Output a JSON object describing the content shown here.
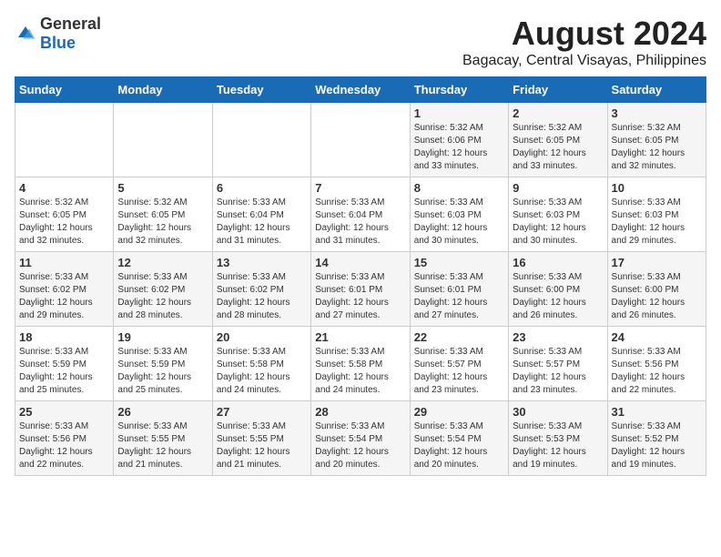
{
  "header": {
    "logo_general": "General",
    "logo_blue": "Blue",
    "month_year": "August 2024",
    "location": "Bagacay, Central Visayas, Philippines"
  },
  "days_of_week": [
    "Sunday",
    "Monday",
    "Tuesday",
    "Wednesday",
    "Thursday",
    "Friday",
    "Saturday"
  ],
  "weeks": [
    [
      {
        "day": "",
        "content": ""
      },
      {
        "day": "",
        "content": ""
      },
      {
        "day": "",
        "content": ""
      },
      {
        "day": "",
        "content": ""
      },
      {
        "day": "1",
        "content": "Sunrise: 5:32 AM\nSunset: 6:06 PM\nDaylight: 12 hours\nand 33 minutes."
      },
      {
        "day": "2",
        "content": "Sunrise: 5:32 AM\nSunset: 6:05 PM\nDaylight: 12 hours\nand 33 minutes."
      },
      {
        "day": "3",
        "content": "Sunrise: 5:32 AM\nSunset: 6:05 PM\nDaylight: 12 hours\nand 32 minutes."
      }
    ],
    [
      {
        "day": "4",
        "content": "Sunrise: 5:32 AM\nSunset: 6:05 PM\nDaylight: 12 hours\nand 32 minutes."
      },
      {
        "day": "5",
        "content": "Sunrise: 5:32 AM\nSunset: 6:05 PM\nDaylight: 12 hours\nand 32 minutes."
      },
      {
        "day": "6",
        "content": "Sunrise: 5:33 AM\nSunset: 6:04 PM\nDaylight: 12 hours\nand 31 minutes."
      },
      {
        "day": "7",
        "content": "Sunrise: 5:33 AM\nSunset: 6:04 PM\nDaylight: 12 hours\nand 31 minutes."
      },
      {
        "day": "8",
        "content": "Sunrise: 5:33 AM\nSunset: 6:03 PM\nDaylight: 12 hours\nand 30 minutes."
      },
      {
        "day": "9",
        "content": "Sunrise: 5:33 AM\nSunset: 6:03 PM\nDaylight: 12 hours\nand 30 minutes."
      },
      {
        "day": "10",
        "content": "Sunrise: 5:33 AM\nSunset: 6:03 PM\nDaylight: 12 hours\nand 29 minutes."
      }
    ],
    [
      {
        "day": "11",
        "content": "Sunrise: 5:33 AM\nSunset: 6:02 PM\nDaylight: 12 hours\nand 29 minutes."
      },
      {
        "day": "12",
        "content": "Sunrise: 5:33 AM\nSunset: 6:02 PM\nDaylight: 12 hours\nand 28 minutes."
      },
      {
        "day": "13",
        "content": "Sunrise: 5:33 AM\nSunset: 6:02 PM\nDaylight: 12 hours\nand 28 minutes."
      },
      {
        "day": "14",
        "content": "Sunrise: 5:33 AM\nSunset: 6:01 PM\nDaylight: 12 hours\nand 27 minutes."
      },
      {
        "day": "15",
        "content": "Sunrise: 5:33 AM\nSunset: 6:01 PM\nDaylight: 12 hours\nand 27 minutes."
      },
      {
        "day": "16",
        "content": "Sunrise: 5:33 AM\nSunset: 6:00 PM\nDaylight: 12 hours\nand 26 minutes."
      },
      {
        "day": "17",
        "content": "Sunrise: 5:33 AM\nSunset: 6:00 PM\nDaylight: 12 hours\nand 26 minutes."
      }
    ],
    [
      {
        "day": "18",
        "content": "Sunrise: 5:33 AM\nSunset: 5:59 PM\nDaylight: 12 hours\nand 25 minutes."
      },
      {
        "day": "19",
        "content": "Sunrise: 5:33 AM\nSunset: 5:59 PM\nDaylight: 12 hours\nand 25 minutes."
      },
      {
        "day": "20",
        "content": "Sunrise: 5:33 AM\nSunset: 5:58 PM\nDaylight: 12 hours\nand 24 minutes."
      },
      {
        "day": "21",
        "content": "Sunrise: 5:33 AM\nSunset: 5:58 PM\nDaylight: 12 hours\nand 24 minutes."
      },
      {
        "day": "22",
        "content": "Sunrise: 5:33 AM\nSunset: 5:57 PM\nDaylight: 12 hours\nand 23 minutes."
      },
      {
        "day": "23",
        "content": "Sunrise: 5:33 AM\nSunset: 5:57 PM\nDaylight: 12 hours\nand 23 minutes."
      },
      {
        "day": "24",
        "content": "Sunrise: 5:33 AM\nSunset: 5:56 PM\nDaylight: 12 hours\nand 22 minutes."
      }
    ],
    [
      {
        "day": "25",
        "content": "Sunrise: 5:33 AM\nSunset: 5:56 PM\nDaylight: 12 hours\nand 22 minutes."
      },
      {
        "day": "26",
        "content": "Sunrise: 5:33 AM\nSunset: 5:55 PM\nDaylight: 12 hours\nand 21 minutes."
      },
      {
        "day": "27",
        "content": "Sunrise: 5:33 AM\nSunset: 5:55 PM\nDaylight: 12 hours\nand 21 minutes."
      },
      {
        "day": "28",
        "content": "Sunrise: 5:33 AM\nSunset: 5:54 PM\nDaylight: 12 hours\nand 20 minutes."
      },
      {
        "day": "29",
        "content": "Sunrise: 5:33 AM\nSunset: 5:54 PM\nDaylight: 12 hours\nand 20 minutes."
      },
      {
        "day": "30",
        "content": "Sunrise: 5:33 AM\nSunset: 5:53 PM\nDaylight: 12 hours\nand 19 minutes."
      },
      {
        "day": "31",
        "content": "Sunrise: 5:33 AM\nSunset: 5:52 PM\nDaylight: 12 hours\nand 19 minutes."
      }
    ]
  ]
}
